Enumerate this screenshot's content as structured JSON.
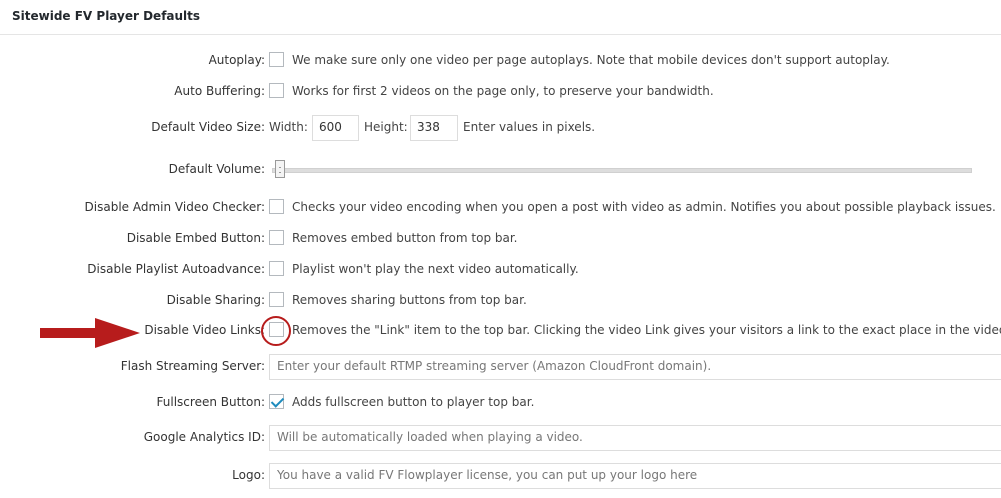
{
  "panel": {
    "title": "Sitewide FV Player Defaults"
  },
  "rows": {
    "autoplay": {
      "label": "Autoplay:",
      "checked": false,
      "desc": "We make sure only one video per page autoplays. Note that mobile devices don't support autoplay."
    },
    "auto_buffering": {
      "label": "Auto Buffering:",
      "checked": false,
      "desc": "Works for first 2 videos on the page only, to preserve your bandwidth."
    },
    "video_size": {
      "label": "Default Video Size:",
      "width_label": "Width:",
      "width": "600",
      "height_label": "Height:",
      "height": "338",
      "note": "Enter values in pixels."
    },
    "volume": {
      "label": "Default Volume:"
    },
    "admin_checker": {
      "label": "Disable Admin Video Checker:",
      "checked": false,
      "desc": "Checks your video encoding when you open a post with video as admin. Notifies you about possible playback issues."
    },
    "embed_button": {
      "label": "Disable Embed Button:",
      "checked": false,
      "desc": "Removes embed button from top bar."
    },
    "playlist_autoadvance": {
      "label": "Disable Playlist Autoadvance:",
      "checked": false,
      "desc": "Playlist won't play the next video automatically."
    },
    "sharing": {
      "label": "Disable Sharing:",
      "checked": false,
      "desc": "Removes sharing buttons from top bar."
    },
    "video_links": {
      "label": "Disable Video Links:",
      "checked": false,
      "desc": "Removes the \"Link\" item to the top bar. Clicking the video Link gives your visitors a link to the exact place in the video they a"
    },
    "flash_server": {
      "label": "Flash Streaming Server:",
      "placeholder": "Enter your default RTMP streaming server (Amazon CloudFront domain)."
    },
    "fullscreen": {
      "label": "Fullscreen Button:",
      "checked": true,
      "desc": "Adds fullscreen button to player top bar."
    },
    "analytics": {
      "label": "Google Analytics ID:",
      "placeholder": "Will be automatically loaded when playing a video."
    },
    "logo": {
      "label": "Logo:",
      "placeholder": "You have a valid FV Flowplayer license, you can put up your logo here"
    }
  },
  "colors": {
    "annotation": "#b71c1c",
    "check": "#1e8cbe"
  },
  "icons": {
    "pointer": "red-arrow-icon",
    "highlight": "red-circle-highlight"
  }
}
